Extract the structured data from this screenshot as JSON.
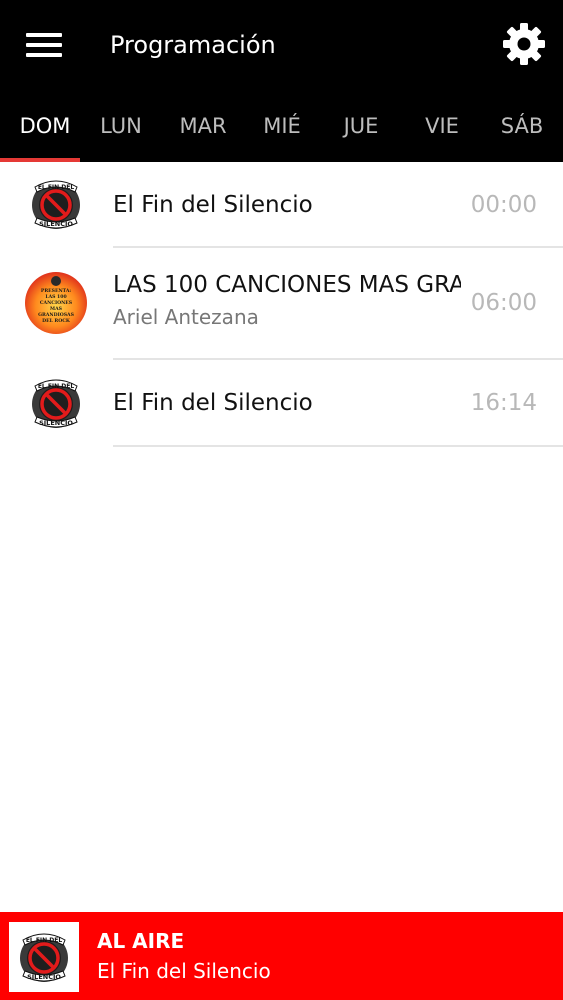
{
  "header": {
    "title": "Programación",
    "menu_icon": "hamburger-menu-icon",
    "settings_icon": "gear-icon"
  },
  "tabs": [
    {
      "label": "DOM",
      "active": true
    },
    {
      "label": "LUN",
      "active": false
    },
    {
      "label": "MAR",
      "active": false
    },
    {
      "label": "MIÉ",
      "active": false
    },
    {
      "label": "JUE",
      "active": false
    },
    {
      "label": "VIE",
      "active": false
    },
    {
      "label": "SÁB",
      "active": false
    }
  ],
  "schedule": [
    {
      "name": "El Fin del Silencio",
      "host": "",
      "time": "00:00",
      "thumb": "el-fin-del-silencio-logo"
    },
    {
      "name": "LAS 100 CANCIONES MAS GRA",
      "host": "Ariel Antezana",
      "time": "06:00",
      "thumb": "las-100-canciones-logo"
    },
    {
      "name": "El Fin del Silencio",
      "host": "",
      "time": "16:14",
      "thumb": "el-fin-del-silencio-logo"
    }
  ],
  "player": {
    "status": "AL AIRE",
    "now_playing": "El Fin del Silencio",
    "play_icon": "play-icon"
  },
  "colors": {
    "header_bg": "#000000",
    "accent": "#ff0000",
    "tab_indicator": "#e53935"
  },
  "logo_text": {
    "top": "EL FIN DEL",
    "bottom": "SILENCIO",
    "poster_lines": [
      "PRESENTA:",
      "LAS 100",
      "CANCIONES",
      "MAS",
      "GRANDIOSAS",
      "DEL ROCK"
    ]
  }
}
